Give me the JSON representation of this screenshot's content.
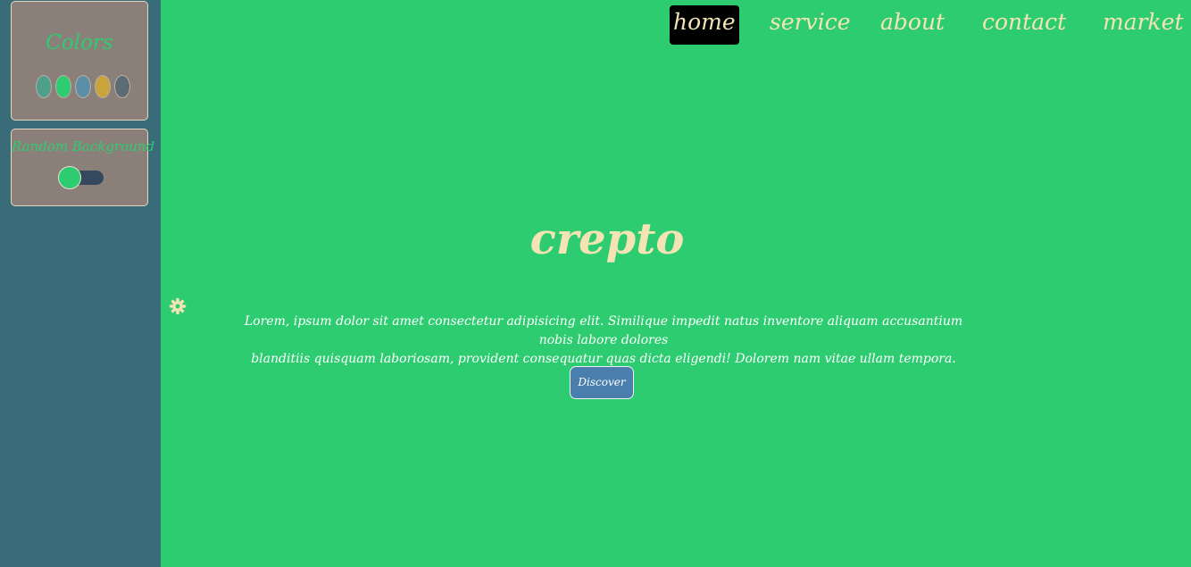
{
  "settings": {
    "colors_title": "Colors",
    "swatches": [
      {
        "color": "#4fa08b"
      },
      {
        "color": "#2ecc71"
      },
      {
        "color": "#5b8fa8"
      },
      {
        "color": "#c9a43a"
      },
      {
        "color": "#5d6b73"
      }
    ],
    "random_background_title": "Random Background",
    "random_background_on": true,
    "gear_icon": "gear-icon"
  },
  "nav": {
    "items": [
      {
        "label": "home",
        "active": true
      },
      {
        "label": "service"
      },
      {
        "label": "about"
      },
      {
        "label": "contact"
      },
      {
        "label": "market"
      }
    ]
  },
  "hero": {
    "title": "crepto",
    "text_line1": "Lorem, ipsum dolor sit amet consectetur adipisicing elit. Similique impedit natus inventore aliquam accusantium nobis labore dolores",
    "text_line2": "blanditiis quisquam laboriosam, provident consequatur quas dicta eligendi! Dolorem nam vitae ullam tempora.",
    "button_label": "Discover"
  },
  "colors": {
    "main_background": "#2ecc71",
    "sidebar_background": "#3a6b78",
    "accent_text": "#f4e4b4",
    "button_background": "#4a7fad"
  }
}
